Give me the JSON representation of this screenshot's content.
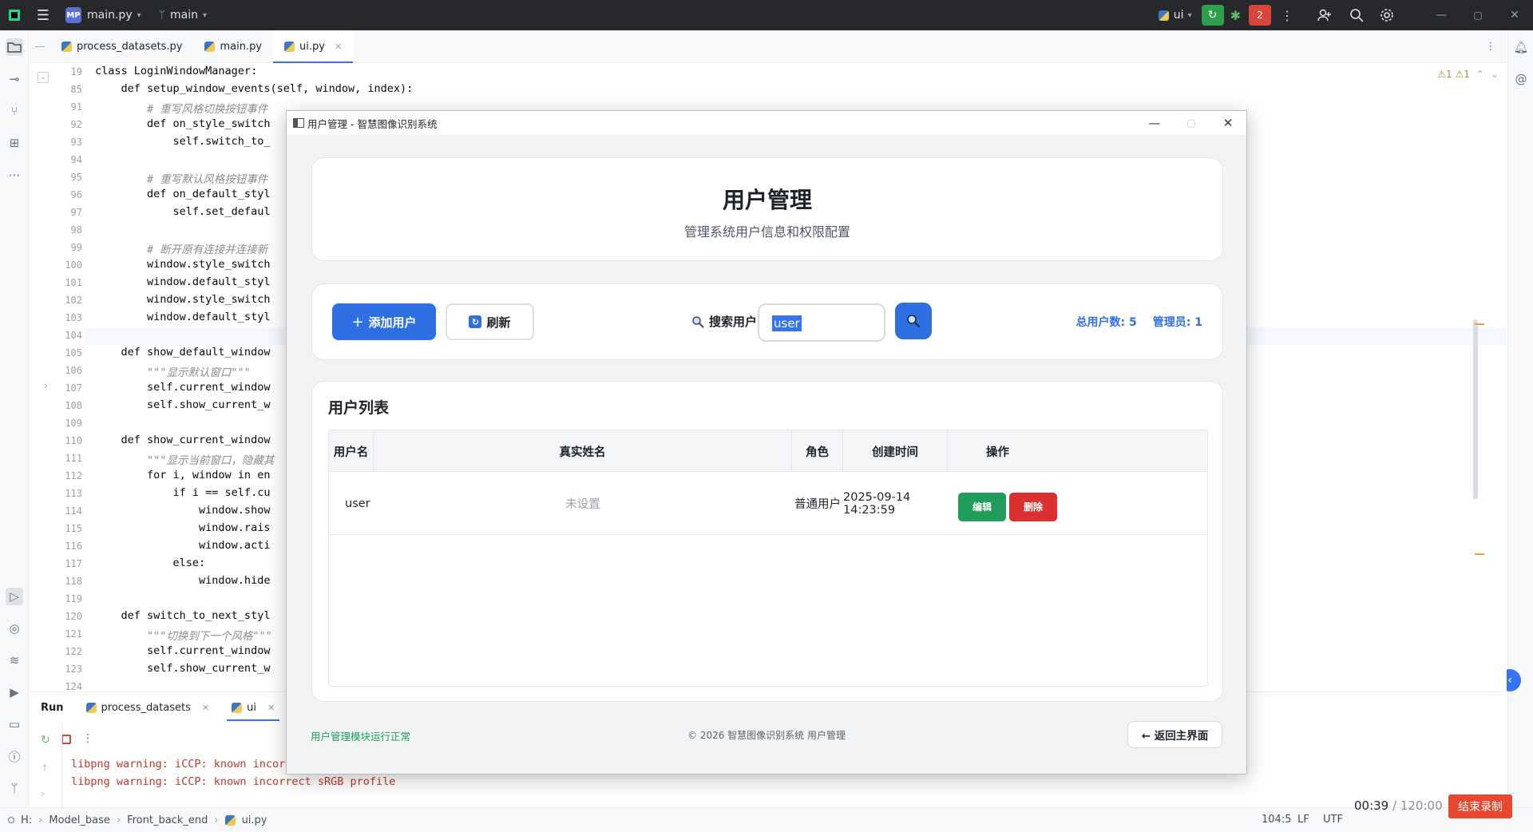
{
  "titlebar": {
    "project_badge": "MP",
    "project_file": "main.py",
    "branch": "main",
    "run_config": "ui",
    "red_badge": "2"
  },
  "tabs": [
    {
      "label": "process_datasets.py"
    },
    {
      "label": "main.py"
    },
    {
      "label": "ui.py"
    }
  ],
  "editor": {
    "warnings": "⚠1  ⚠1",
    "lines": [
      {
        "n": "19",
        "t": "class LoginWindowManager:"
      },
      {
        "n": "85",
        "t": "    def setup_window_events(self, window, index):"
      },
      {
        "n": "91",
        "t": "        # 重写风格切换按钮事件"
      },
      {
        "n": "92",
        "t": "        def on_style_switch"
      },
      {
        "n": "93",
        "t": "            self.switch_to_"
      },
      {
        "n": "94",
        "t": ""
      },
      {
        "n": "95",
        "t": "        # 重写默认风格按钮事件"
      },
      {
        "n": "96",
        "t": "        def on_default_styl"
      },
      {
        "n": "97",
        "t": "            self.set_defaul"
      },
      {
        "n": "98",
        "t": ""
      },
      {
        "n": "99",
        "t": "        # 断开原有连接并连接新"
      },
      {
        "n": "100",
        "t": "        window.style_switch"
      },
      {
        "n": "101",
        "t": "        window.default_styl"
      },
      {
        "n": "102",
        "t": "        window.style_switch"
      },
      {
        "n": "103",
        "t": "        window.default_styl"
      },
      {
        "n": "104",
        "t": ""
      },
      {
        "n": "105",
        "t": "    def show_default_window"
      },
      {
        "n": "106",
        "t": "        \"\"\"显示默认窗口\"\"\""
      },
      {
        "n": "107",
        "t": "        self.current_window"
      },
      {
        "n": "108",
        "t": "        self.show_current_w"
      },
      {
        "n": "109",
        "t": ""
      },
      {
        "n": "110",
        "t": "    def show_current_window"
      },
      {
        "n": "111",
        "t": "        \"\"\"显示当前窗口，隐藏其"
      },
      {
        "n": "112",
        "t": "        for i, window in en"
      },
      {
        "n": "113",
        "t": "            if i == self.cu"
      },
      {
        "n": "114",
        "t": "                window.show"
      },
      {
        "n": "115",
        "t": "                window.rais"
      },
      {
        "n": "116",
        "t": "                window.acti"
      },
      {
        "n": "117",
        "t": "            else:"
      },
      {
        "n": "118",
        "t": "                window.hide"
      },
      {
        "n": "119",
        "t": ""
      },
      {
        "n": "120",
        "t": "    def switch_to_next_styl"
      },
      {
        "n": "121",
        "t": "        \"\"\"切换到下一个风格\"\"\""
      },
      {
        "n": "122",
        "t": "        self.current_window"
      },
      {
        "n": "123",
        "t": "        self.show_current_w"
      },
      {
        "n": "124",
        "t": ""
      }
    ]
  },
  "run_panel": {
    "title": "Run",
    "tabs": [
      {
        "label": "process_datasets"
      },
      {
        "label": "ui"
      }
    ],
    "console": [
      "libpng warning: iCCP: known incorr",
      "libpng warning: iCCP: known incorrect sRGB profile"
    ]
  },
  "statusbar": {
    "breadcrumbs": [
      "H:",
      "Model_base",
      "Front_back_end",
      "ui.py"
    ],
    "position": "104:5",
    "line_sep": "LF",
    "encoding": "UTF"
  },
  "recorder": {
    "elapsed": "00:39",
    "total": "/ 120:00",
    "stop_label": "结束录制"
  },
  "dialog": {
    "window_title": "用户管理 - 智慧图像识别系统",
    "header": {
      "title": "用户管理",
      "subtitle": "管理系统用户信息和权限配置"
    },
    "toolbar": {
      "add_label": "添加用户",
      "refresh_label": "刷新",
      "search_label": "搜索用户:",
      "search_value": "user",
      "stat_total": "总用户数: 5",
      "stat_admin": "管理员: 1"
    },
    "list": {
      "title": "用户列表",
      "columns": [
        "用户名",
        "真实姓名",
        "角色",
        "创建时间",
        "操作"
      ],
      "rows": [
        {
          "username": "user",
          "realname": "未设置",
          "role": "普通用户",
          "created": "2025-09-14 14:23:59",
          "edit": "编辑",
          "delete": "删除"
        }
      ]
    },
    "footer": {
      "status": "用户管理模块运行正常",
      "copyright": "© 2026 智慧图像识别系统    用户管理",
      "back_label": "← 返回主界面"
    }
  },
  "colors": {
    "primary": "#2f6fe4",
    "success": "#1f9e5b",
    "danger": "#dc2f2f",
    "recorder_stop": "#e9472f"
  }
}
